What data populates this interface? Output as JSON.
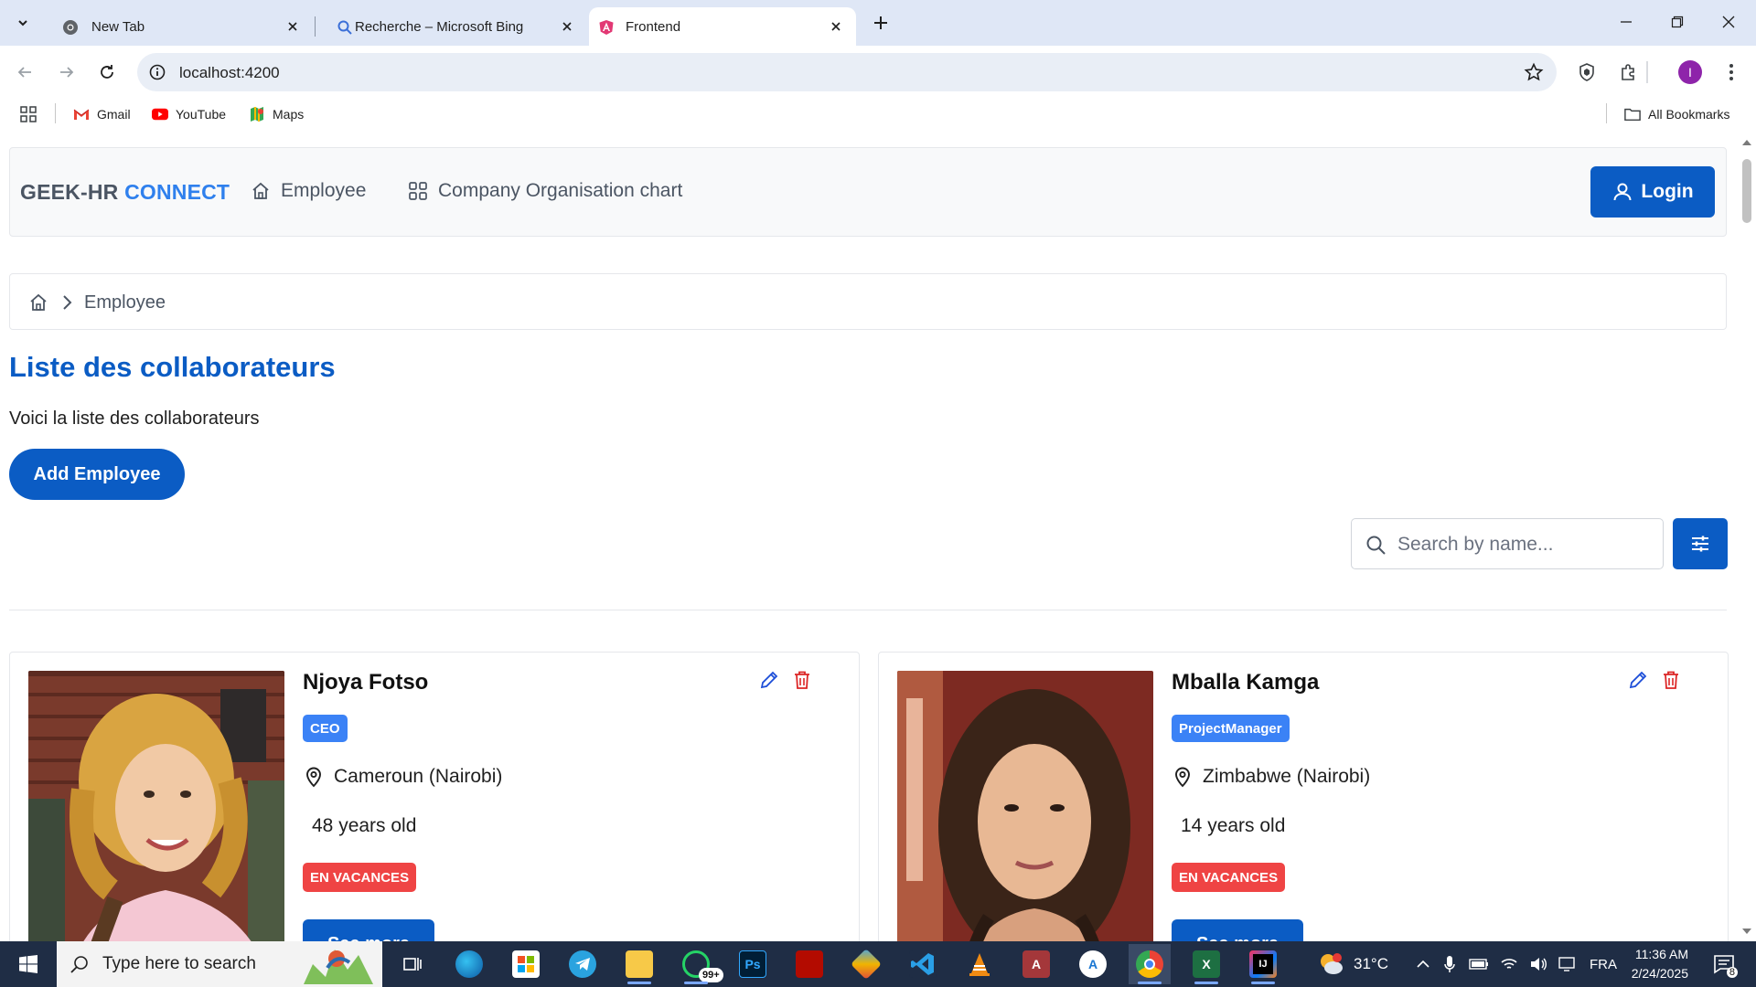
{
  "browser": {
    "tabs": [
      {
        "title": "New Tab",
        "icon": "chrome-icon"
      },
      {
        "title": "Recherche – Microsoft Bing",
        "icon": "search-icon"
      },
      {
        "title": "Frontend",
        "icon": "angular-icon"
      }
    ],
    "url": "localhost:4200",
    "profile_initial": "I",
    "bookmarks": [
      {
        "label": "Gmail",
        "icon": "gmail-icon"
      },
      {
        "label": "YouTube",
        "icon": "youtube-icon"
      },
      {
        "label": "Maps",
        "icon": "maps-icon"
      }
    ],
    "all_bookmarks": "All Bookmarks"
  },
  "app": {
    "brand_part1": "GEEK-HR",
    "brand_part2": "CONNECT",
    "nav": [
      {
        "label": "Employee",
        "icon": "home-icon"
      },
      {
        "label": "Company Organisation chart",
        "icon": "grid-icon"
      }
    ],
    "login_label": "Login",
    "breadcrumb_current": "Employee",
    "page_title": "Liste des collaborateurs",
    "page_subtitle": "Voici la liste des collaborateurs",
    "add_button": "Add Employee",
    "search_placeholder": "Search by name...",
    "colors": {
      "primary": "#0b5cc4",
      "accent": "#2f80ed",
      "role_badge": "#3b82f6",
      "status_badge": "#ef4444"
    }
  },
  "employees": [
    {
      "name": "Njoya Fotso",
      "role": "CEO",
      "location": "Cameroun (Nairobi)",
      "age": "48 years old",
      "status": "EN VACANCES",
      "see_more": "See more"
    },
    {
      "name": "Mballa Kamga",
      "role": "ProjectManager",
      "location": "Zimbabwe (Nairobi)",
      "age": "14 years old",
      "status": "EN VACANCES",
      "see_more": "See more"
    }
  ],
  "taskbar": {
    "search_placeholder": "Type here to search",
    "whatsapp_badge": "99+",
    "weather_temp": "31°C",
    "language": "FRA",
    "time": "11:36 AM",
    "date": "2/24/2025",
    "notifications": "8"
  }
}
